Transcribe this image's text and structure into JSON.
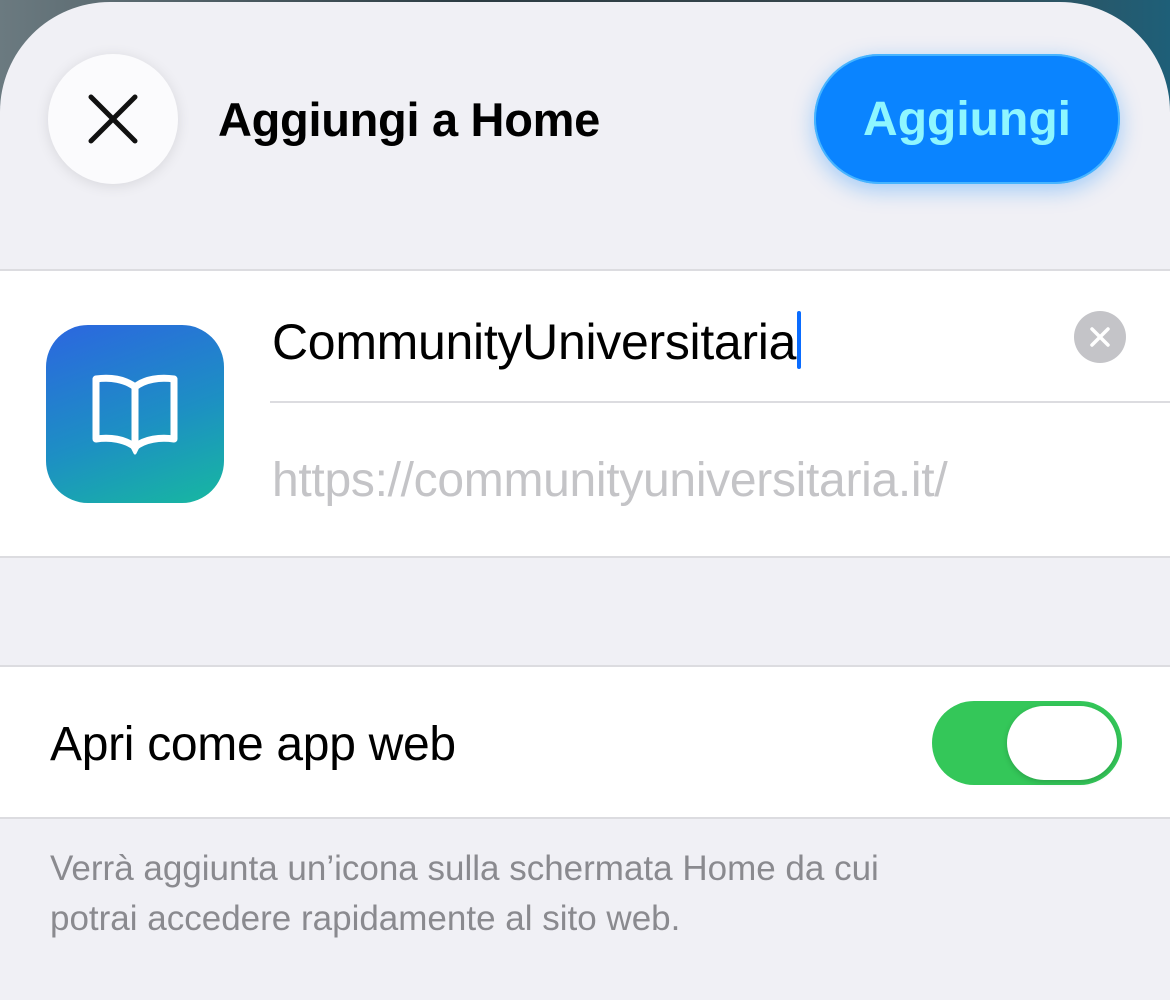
{
  "header": {
    "title": "Aggiungi a Home",
    "close_icon": "close-icon",
    "add_label": "Aggiungi"
  },
  "app": {
    "icon": "book-open-icon",
    "name_value": "CommunityUniversitaria",
    "clear_icon": "clear-circle-icon",
    "url": "https://communityuniversitaria.it/"
  },
  "settings": {
    "open_as_web_app_label": "Apri come app web",
    "open_as_web_app_enabled": true
  },
  "footnote": {
    "line1": "Verrà aggiunta un’icona sulla schermata Home da cui",
    "line2": "potrai accedere rapidamente al sito web."
  },
  "colors": {
    "accent": "#0a84ff",
    "add_label_color": "#8ef6ff",
    "toggle_on": "#34c759",
    "sheet_background": "#f0f0f5",
    "secondary_text": "#8a8a8f",
    "placeholder_text": "#c4c4c7",
    "icon_gradient_top": "#2c66e0",
    "icon_gradient_bottom": "#17b8a0"
  }
}
